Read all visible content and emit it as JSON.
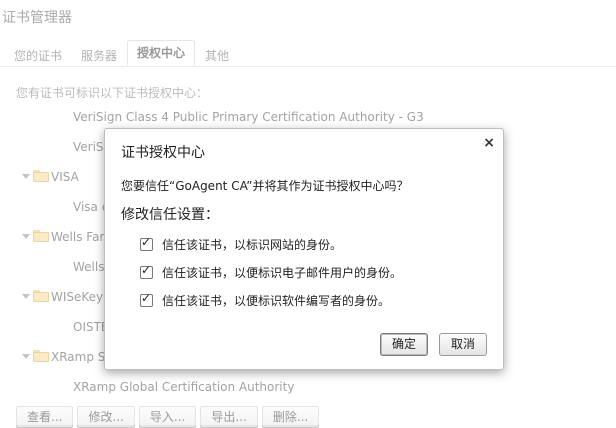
{
  "page": {
    "title": "证书管理器",
    "tabs": [
      "您的证书",
      "服务器",
      "授权中心",
      "其他"
    ],
    "description": "您有证书可标识以下证书授权中心：",
    "tree": {
      "cert1": "VeriSign Class 4 Public Primary Certification Authority - G3",
      "cert2": "VeriS",
      "org1": "VISA",
      "cert3": "Visa e",
      "org2": "Wells Far",
      "cert4": "Wells",
      "org3": "WISeKey",
      "cert5": "OISTE",
      "org4": "XRamp S",
      "cert6": "XRamp Global Certification Authority"
    },
    "buttons": [
      "查看...",
      "修改...",
      "导入...",
      "导出...",
      "删除..."
    ]
  },
  "dialog": {
    "title": "证书授权中心",
    "close_icon": "×",
    "question": "您要信任“GoAgent CA”并将其作为证书授权中心吗？",
    "subtitle": "修改信任设置：",
    "options": [
      {
        "label": "信任该证书，以标识网站的身份。",
        "checked": true
      },
      {
        "label": "信任该证书，以便标识电子邮件用户的身份。",
        "checked": true
      },
      {
        "label": "信任该证书，以便标识软件编写者的身份。",
        "checked": true
      }
    ],
    "ok_label": "确定",
    "cancel_label": "取消"
  }
}
